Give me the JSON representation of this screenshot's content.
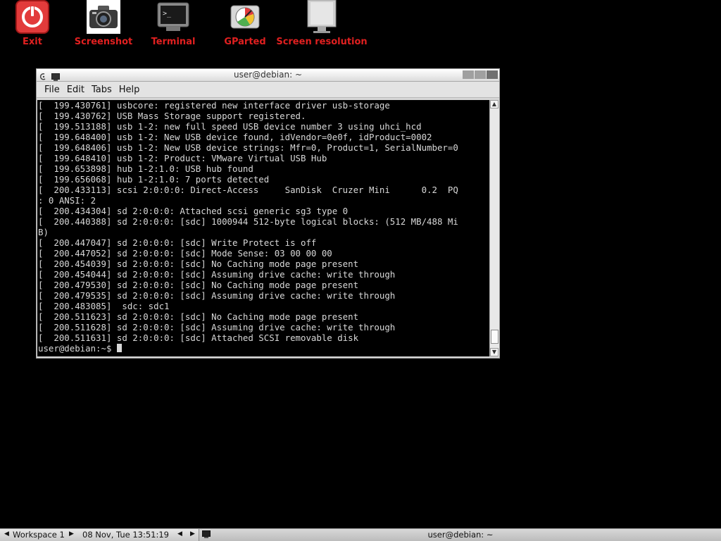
{
  "desktop_icons": [
    {
      "label": "Exit",
      "icon": "power-icon"
    },
    {
      "label": "Screenshot",
      "icon": "camera-icon"
    },
    {
      "label": "Terminal",
      "icon": "terminal-icon"
    },
    {
      "label": "GParted",
      "icon": "disk-gauge-icon"
    },
    {
      "label": "Screen resolution",
      "icon": "monitor-icon"
    }
  ],
  "window": {
    "title": "user@debian: ~",
    "menu": [
      "File",
      "Edit",
      "Tabs",
      "Help"
    ],
    "lines": [
      "[  199.430761] usbcore: registered new interface driver usb-storage",
      "[  199.430762] USB Mass Storage support registered.",
      "[  199.513188] usb 1-2: new full speed USB device number 3 using uhci_hcd",
      "[  199.648400] usb 1-2: New USB device found, idVendor=0e0f, idProduct=0002",
      "[  199.648406] usb 1-2: New USB device strings: Mfr=0, Product=1, SerialNumber=0",
      "[  199.648410] usb 1-2: Product: VMware Virtual USB Hub",
      "[  199.653898] hub 1-2:1.0: USB hub found",
      "[  199.656068] hub 1-2:1.0: 7 ports detected",
      "[  200.433113] scsi 2:0:0:0: Direct-Access     SanDisk  Cruzer Mini      0.2  PQ",
      ": 0 ANSI: 2",
      "[  200.434304] sd 2:0:0:0: Attached scsi generic sg3 type 0",
      "[  200.440388] sd 2:0:0:0: [sdc] 1000944 512-byte logical blocks: (512 MB/488 Mi",
      "B)",
      "[  200.447047] sd 2:0:0:0: [sdc] Write Protect is off",
      "[  200.447052] sd 2:0:0:0: [sdc] Mode Sense: 03 00 00 00",
      "[  200.454039] sd 2:0:0:0: [sdc] No Caching mode page present",
      "[  200.454044] sd 2:0:0:0: [sdc] Assuming drive cache: write through",
      "[  200.479530] sd 2:0:0:0: [sdc] No Caching mode page present",
      "[  200.479535] sd 2:0:0:0: [sdc] Assuming drive cache: write through",
      "[  200.483085]  sdc: sdc1",
      "[  200.511623] sd 2:0:0:0: [sdc] No Caching mode page present",
      "[  200.511628] sd 2:0:0:0: [sdc] Assuming drive cache: write through",
      "[  200.511631] sd 2:0:0:0: [sdc] Attached SCSI removable disk"
    ],
    "prompt": "user@debian:~$ "
  },
  "panel": {
    "workspace": "Workspace 1",
    "clock": "08 Nov, Tue 13:51:19",
    "task_title": "user@debian: ~"
  },
  "colors": {
    "label_red": "#e02020",
    "terminal_bg": "#000000",
    "terminal_fg": "#d8d8d8"
  }
}
